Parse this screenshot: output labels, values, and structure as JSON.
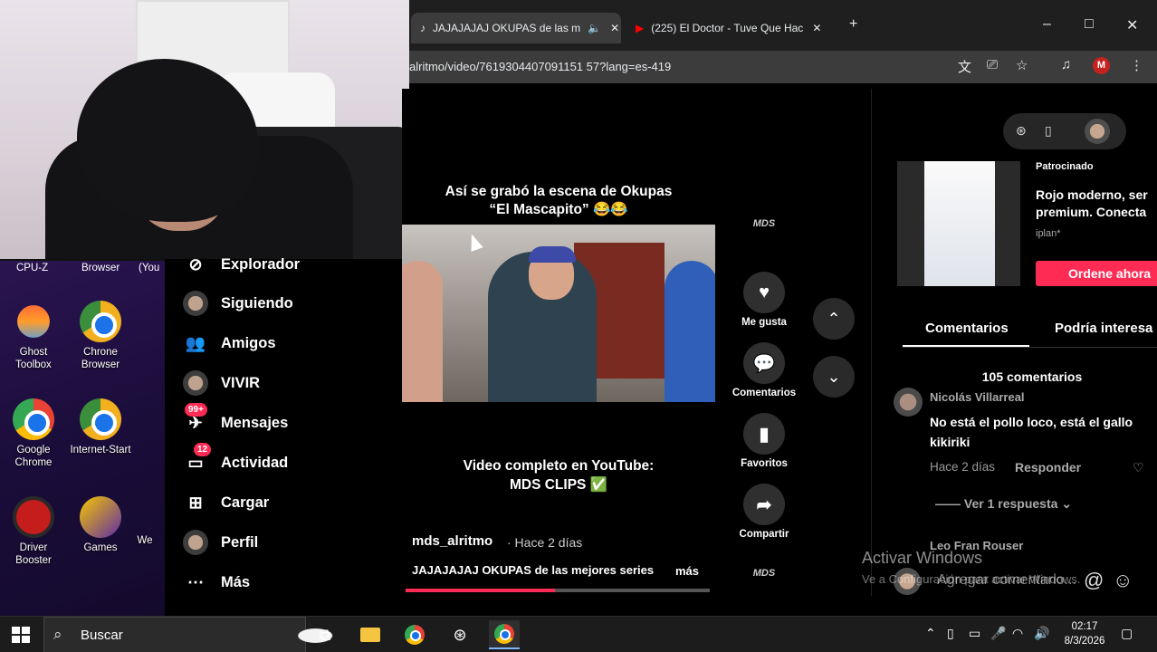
{
  "browser": {
    "tabs": [
      {
        "label": "JAJAJAJAJ OKUPAS de las m",
        "active": true
      },
      {
        "label": "(225) El Doctor - Tuve Que Hac",
        "active": false
      }
    ],
    "new_tab_symbol": "+",
    "url": "alritmo/video/7619304407091151 57?lang=es-419",
    "profile_initial": "M"
  },
  "desktop": {
    "top_row": [
      "CPU-Z",
      "Browser",
      "(You"
    ],
    "icons": [
      {
        "label": "Ghost Toolbox",
        "icon": "ghost-toolbox-icon"
      },
      {
        "label": "Chrone Browser",
        "icon": "chrome-icon"
      },
      {
        "label": "Google Chrome",
        "icon": "chrome-icon"
      },
      {
        "label": "Internet-Start",
        "icon": "chrome-icon"
      },
      {
        "label": "Driver Booster",
        "icon": "driver-booster-icon"
      },
      {
        "label": "Games",
        "icon": "games-icon"
      },
      {
        "label": "We",
        "icon": "app-icon"
      }
    ]
  },
  "nav": {
    "items": [
      {
        "label": "Explorador",
        "icon": "compass-icon"
      },
      {
        "label": "Siguiendo",
        "icon": "avatar"
      },
      {
        "label": "Amigos",
        "icon": "friends-icon"
      },
      {
        "label": "VIVIR",
        "icon": "avatar"
      },
      {
        "label": "Mensajes",
        "icon": "message-icon",
        "badge": "99+"
      },
      {
        "label": "Actividad",
        "icon": "inbox-icon",
        "badge": "12"
      },
      {
        "label": "Cargar",
        "icon": "upload-icon"
      },
      {
        "label": "Perfil",
        "icon": "avatar"
      },
      {
        "label": "Más",
        "icon": "more-icon"
      }
    ]
  },
  "video": {
    "caption_top_line1": "Así se grabó la escena de Okupas",
    "caption_top_line2": "“El Mascapito” 😂😂",
    "caption_bottom_line1": "Video completo en YouTube:",
    "caption_bottom_line2": "MDS CLIPS ✅",
    "author": "mds_alritmo",
    "posted": "· Hace 2 días",
    "description": "JAJAJAJAJ OKUPAS de las mejores series",
    "more": "más",
    "progress": 0.49
  },
  "actions": {
    "likes_label": "Me gusta",
    "comments_label": "Comentarios",
    "favorites_label": "Favoritos",
    "share_label": "Compartir",
    "logo_text": "MDS"
  },
  "right": {
    "ad_label": "Patrocinado",
    "ad_text_line1": "Rojo moderno, ser",
    "ad_text_line2": "premium. Conecta",
    "ad_brand": "iplan*",
    "ad_button": "Ordene ahora",
    "tab_comments": "Comentarios",
    "tab_related": "Podría interesa",
    "comment_count": "105 comentarios",
    "comment_user": "Nicolás Villarreal",
    "comment_text": "No está el pollo loco, está el gallo kikiriki",
    "comment_date": "Hace 2 días",
    "reply_label": "Responder",
    "view_replies": "Ver 1 respuesta",
    "next_user": "Leo Fran Rouser",
    "input_placeholder": "Agregar comentario...",
    "at_symbol": "@",
    "activate_title": "Activar Windows",
    "activate_sub": "Ve a Configuración para activar Windows."
  },
  "taskbar": {
    "search_placeholder": "Buscar",
    "time": "02:17",
    "date": "8/3/2026"
  }
}
